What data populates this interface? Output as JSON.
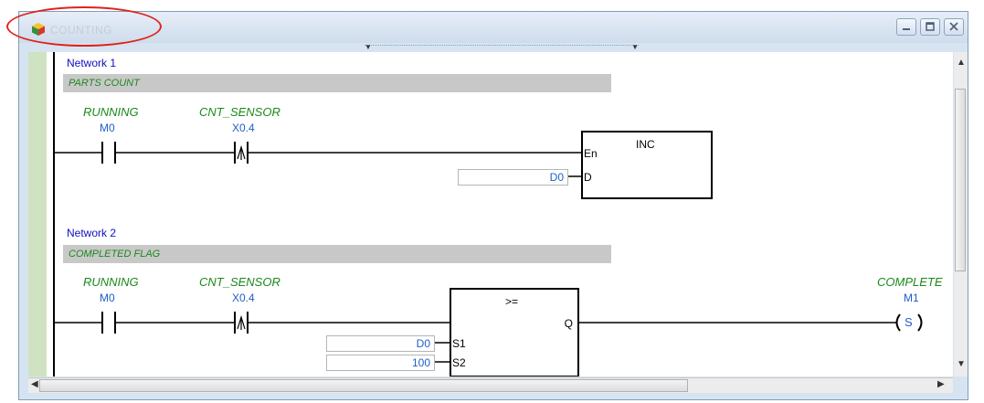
{
  "window": {
    "title": "COUNTING"
  },
  "networks": [
    {
      "label": "Network 1",
      "comment": "PARTS COUNT",
      "contacts": [
        {
          "tag": "RUNNING",
          "address": "M0"
        },
        {
          "tag": "CNT_SENSOR",
          "address": "X0.4"
        }
      ],
      "block": {
        "name": "INC",
        "inputs": [
          "En",
          "D"
        ]
      },
      "operands": {
        "D": "D0"
      }
    },
    {
      "label": "Network 2",
      "comment": "COMPLETED FLAG",
      "contacts": [
        {
          "tag": "RUNNING",
          "address": "M0"
        },
        {
          "tag": "CNT_SENSOR",
          "address": "X0.4"
        }
      ],
      "block": {
        "name": ">=",
        "inputs": [
          "S1",
          "S2"
        ],
        "output": "Q"
      },
      "operands": {
        "S1": "D0",
        "S2": "100"
      },
      "coil": {
        "tag": "COMPLETE",
        "address": "M1",
        "symbol": "S"
      }
    }
  ],
  "colors": {
    "tag": "#1a8a1a",
    "address": "#1f5ec8",
    "network_label": "#1010c0",
    "annotation": "#e0231b"
  }
}
